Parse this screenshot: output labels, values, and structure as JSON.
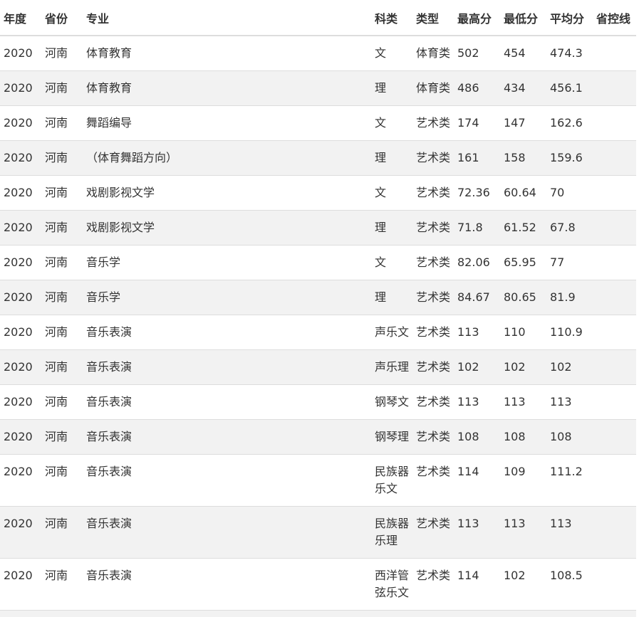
{
  "headers": {
    "year": "年度",
    "province": "省份",
    "major": "专业",
    "subject": "科类",
    "type": "类型",
    "max": "最高分",
    "min": "最低分",
    "avg": "平均分",
    "control": "省控线"
  },
  "rows": [
    {
      "year": "2020",
      "province": "河南",
      "major": "体育教育",
      "subject": "文",
      "type": "体育类",
      "max": "502",
      "min": "454",
      "avg": "474.3",
      "control": ""
    },
    {
      "year": "2020",
      "province": "河南",
      "major": "体育教育",
      "subject": "理",
      "type": "体育类",
      "max": "486",
      "min": "434",
      "avg": "456.1",
      "control": ""
    },
    {
      "year": "2020",
      "province": "河南",
      "major": "舞蹈编导",
      "subject": "文",
      "type": "艺术类",
      "max": "174",
      "min": "147",
      "avg": "162.6",
      "control": ""
    },
    {
      "year": "2020",
      "province": "河南",
      "major": "（体育舞蹈方向）",
      "subject": "理",
      "type": "艺术类",
      "max": "161",
      "min": "158",
      "avg": "159.6",
      "control": ""
    },
    {
      "year": "2020",
      "province": "河南",
      "major": "戏剧影视文学",
      "subject": "文",
      "type": "艺术类",
      "max": "72.36",
      "min": "60.64",
      "avg": "70",
      "control": ""
    },
    {
      "year": "2020",
      "province": "河南",
      "major": "戏剧影视文学",
      "subject": "理",
      "type": "艺术类",
      "max": "71.8",
      "min": "61.52",
      "avg": "67.8",
      "control": ""
    },
    {
      "year": "2020",
      "province": "河南",
      "major": "音乐学",
      "subject": "文",
      "type": "艺术类",
      "max": "82.06",
      "min": "65.95",
      "avg": "77",
      "control": ""
    },
    {
      "year": "2020",
      "province": "河南",
      "major": "音乐学",
      "subject": "理",
      "type": "艺术类",
      "max": "84.67",
      "min": "80.65",
      "avg": "81.9",
      "control": ""
    },
    {
      "year": "2020",
      "province": "河南",
      "major": "音乐表演",
      "subject": "声乐文",
      "type": "艺术类",
      "max": "113",
      "min": "110",
      "avg": "110.9",
      "control": ""
    },
    {
      "year": "2020",
      "province": "河南",
      "major": "音乐表演",
      "subject": "声乐理",
      "type": "艺术类",
      "max": "102",
      "min": "102",
      "avg": "102",
      "control": ""
    },
    {
      "year": "2020",
      "province": "河南",
      "major": "音乐表演",
      "subject": "钢琴文",
      "type": "艺术类",
      "max": "113",
      "min": "113",
      "avg": "113",
      "control": ""
    },
    {
      "year": "2020",
      "province": "河南",
      "major": "音乐表演",
      "subject": "钢琴理",
      "type": "艺术类",
      "max": "108",
      "min": "108",
      "avg": "108",
      "control": ""
    },
    {
      "year": "2020",
      "province": "河南",
      "major": "音乐表演",
      "subject": "民族器乐文",
      "type": "艺术类",
      "max": "114",
      "min": "109",
      "avg": "111.2",
      "control": ""
    },
    {
      "year": "2020",
      "province": "河南",
      "major": "音乐表演",
      "subject": "民族器乐理",
      "type": "艺术类",
      "max": "113",
      "min": "113",
      "avg": "113",
      "control": ""
    },
    {
      "year": "2020",
      "province": "河南",
      "major": "音乐表演",
      "subject": "西洋管弦乐文",
      "type": "艺术类",
      "max": "114",
      "min": "102",
      "avg": "108.5",
      "control": ""
    }
  ]
}
